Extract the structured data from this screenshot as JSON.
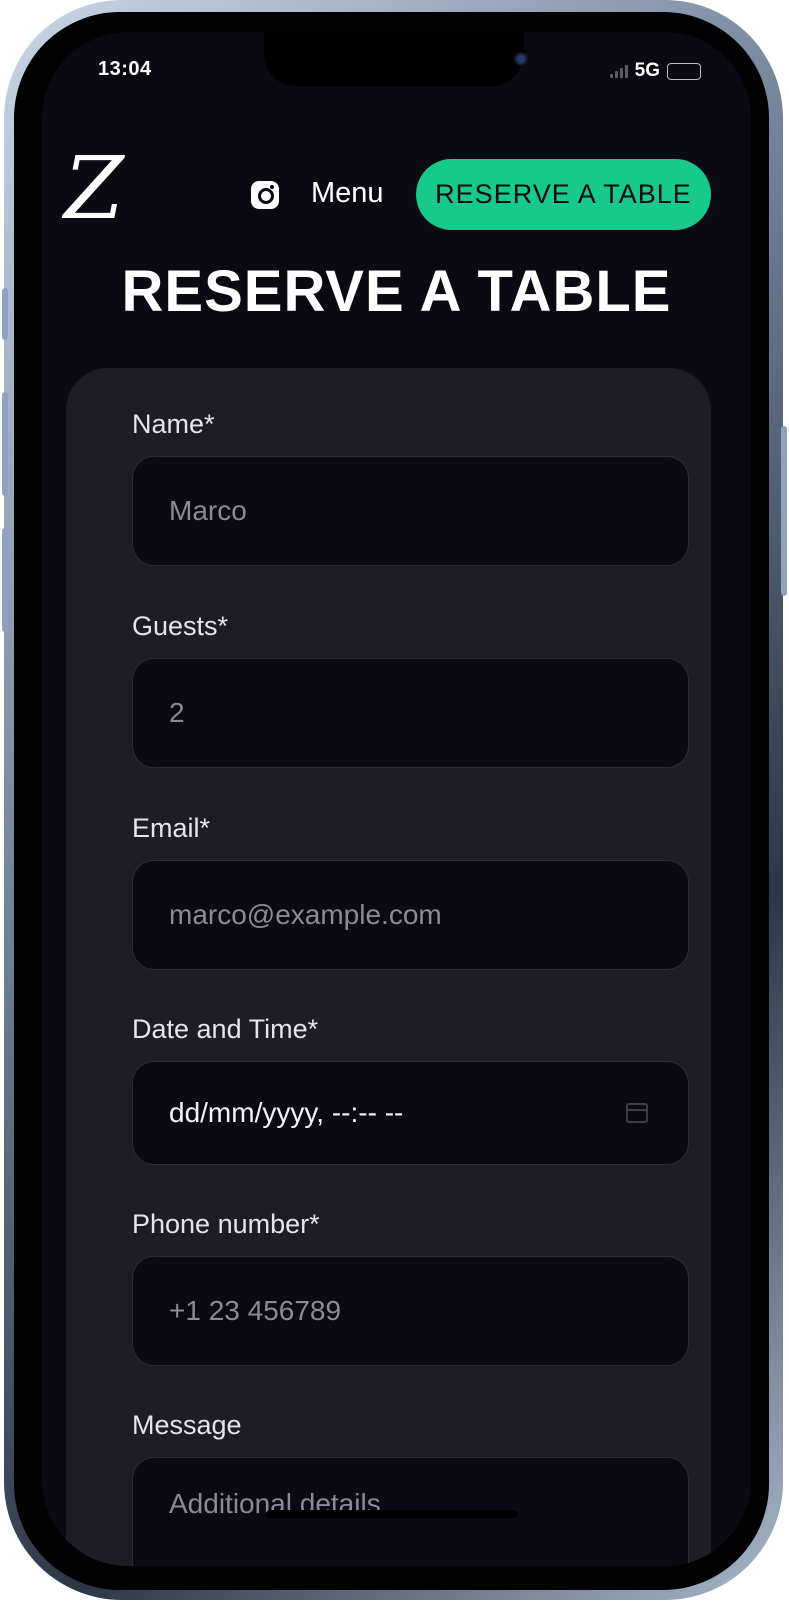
{
  "status_bar": {
    "time": "13:04",
    "network": "5G"
  },
  "header": {
    "logo": "Z",
    "instagram_icon": "instagram-icon",
    "menu_label": "Menu",
    "reserve_button_label": "RESERVE A TABLE"
  },
  "page": {
    "title": "RESERVE A TABLE"
  },
  "form": {
    "name": {
      "label": "Name*",
      "placeholder": "Marco"
    },
    "guests": {
      "label": "Guests*",
      "placeholder": "2"
    },
    "email": {
      "label": "Email*",
      "placeholder": "marco@example.com"
    },
    "datetime": {
      "label": "Date and Time*",
      "value": "dd/mm/yyyy, --:-- --",
      "icon": "calendar-icon"
    },
    "phone": {
      "label": "Phone number*",
      "placeholder": "+1 23 456789"
    },
    "message": {
      "label": "Message",
      "placeholder": "Additional details"
    }
  },
  "colors": {
    "accent": "#17c98a",
    "background": "#0b0a12",
    "card": "#1e1d26",
    "text": "#ffffff",
    "placeholder": "#8b8a95"
  }
}
